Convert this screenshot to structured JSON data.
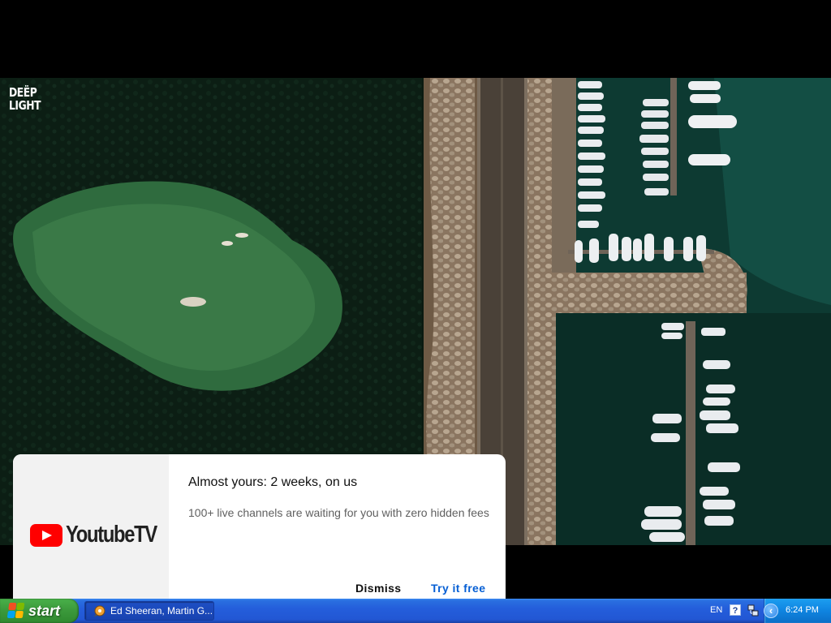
{
  "video": {
    "watermark_line1": "DEËP",
    "watermark_line2": "LIGHT"
  },
  "promo": {
    "logo_text": "YoutubeTV",
    "logo_icon": "youtube-play-icon",
    "title": "Almost yours: 2 weeks, on us",
    "body": "100+ live channels are waiting for you with zero hidden fees",
    "dismiss_label": "Dismiss",
    "try_label": "Try it free",
    "accent_color": "#065fd4",
    "brand_color": "#ff0000"
  },
  "taskbar": {
    "start_label": "start",
    "task_label": "Ed Sheeran, Martin G...",
    "task_icon": "media-player-icon",
    "language": "EN",
    "help_icon": "help-icon",
    "network_icon": "network-icon",
    "expand_icon": "chevron-left-icon",
    "clock": "6:24 PM"
  }
}
